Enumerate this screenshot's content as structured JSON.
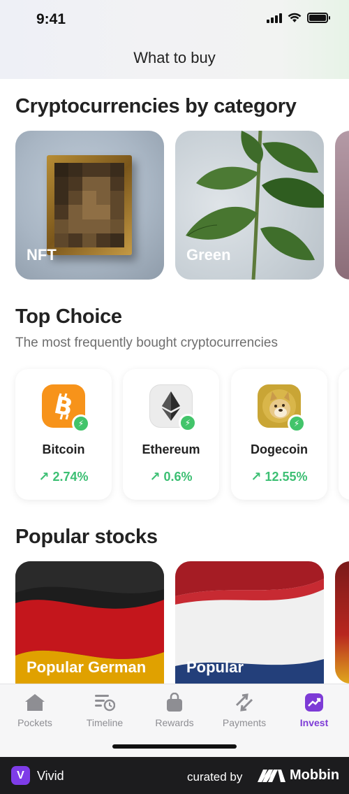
{
  "status_bar": {
    "time": "9:41"
  },
  "header": {
    "title": "What to buy"
  },
  "categories": {
    "title": "Cryptocurrencies by category",
    "items": [
      {
        "label": "NFT"
      },
      {
        "label": "Green"
      }
    ]
  },
  "top_choice": {
    "title": "Top Choice",
    "subtitle": "The most frequently bought cryptocurrencies",
    "coins": [
      {
        "name": "Bitcoin",
        "change": "2.74%",
        "icon": "bitcoin-icon",
        "color": "#f7931a"
      },
      {
        "name": "Ethereum",
        "change": "0.6%",
        "icon": "ethereum-icon",
        "color": "#ededed"
      },
      {
        "name": "Dogecoin",
        "change": "12.55%",
        "icon": "dogecoin-icon",
        "color": "#c9a535"
      }
    ]
  },
  "stocks": {
    "title": "Popular stocks",
    "items": [
      {
        "label": "Popular German"
      },
      {
        "label": "Popular"
      }
    ]
  },
  "tabbar": {
    "tabs": [
      {
        "label": "Pockets",
        "icon": "house-icon"
      },
      {
        "label": "Timeline",
        "icon": "timeline-icon"
      },
      {
        "label": "Rewards",
        "icon": "shopping-bag-icon"
      },
      {
        "label": "Payments",
        "icon": "arrows-swap-icon"
      },
      {
        "label": "Invest",
        "icon": "chart-icon",
        "active": true
      }
    ]
  },
  "footer": {
    "app_name": "Vivid",
    "app_letter": "V",
    "curated_by": "curated by",
    "brand": "Mobbin"
  },
  "colors": {
    "accent": "#7d3bd6",
    "positive": "#3cbf73"
  }
}
